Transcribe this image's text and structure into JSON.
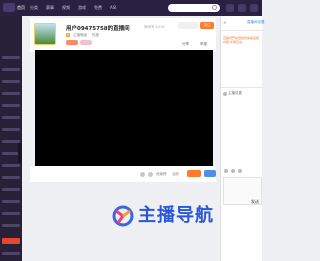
{
  "nav": {
    "items": [
      "首页",
      "分类",
      "赛事",
      "视频",
      "游戏",
      "免费",
      "ASI"
    ]
  },
  "search": {
    "placeholder": ""
  },
  "streamer": {
    "title": "用户09475758的直播间",
    "room_id": "房间号:1018",
    "level": "0",
    "tag_text": "主播等级",
    "meta_hot": "热度",
    "follow_label": "关注"
  },
  "actions": {
    "share": "分享",
    "report": "举报"
  },
  "gift_bar": {
    "labels": [
      "贡献榜",
      "活跃"
    ]
  },
  "chat": {
    "close": "✕",
    "link": "直播间设置",
    "notice": "直播间严禁低俗色情等违规内容,文明互动",
    "label": "主播设置",
    "send": "发送"
  },
  "watermark": {
    "text": "主播导航"
  },
  "colors": {
    "topbar": "#2a2142",
    "sidebar": "#272036",
    "accent_orange": "#ff7a2b",
    "accent_blue": "#4f8fe6",
    "watermark_blue": "#2a56d8"
  }
}
